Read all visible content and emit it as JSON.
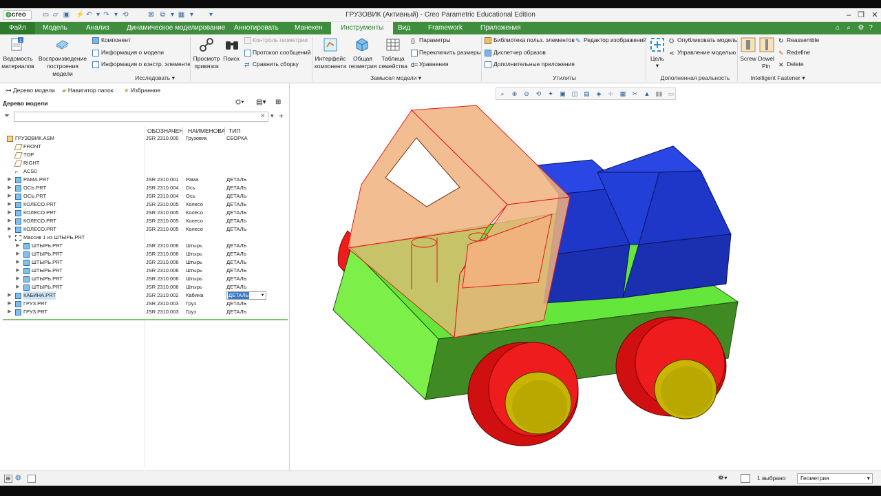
{
  "app": {
    "logo": "creo",
    "window_title": "ГРУЗОВИК (Активный) - Creo Parametric Educational Edition",
    "window_controls": [
      "minimize-icon",
      "restore-icon",
      "close-icon"
    ]
  },
  "tabs": [
    {
      "label": "Файл",
      "type": "file"
    },
    {
      "label": "Модель"
    },
    {
      "label": "Анализ"
    },
    {
      "label": "Динамическое моделирование"
    },
    {
      "label": "Аннотировать"
    },
    {
      "label": "Манекен"
    },
    {
      "label": "Инструменты",
      "active": true
    },
    {
      "label": "Вид"
    },
    {
      "label": "Framework"
    },
    {
      "label": "Приложения"
    }
  ],
  "ribbon": {
    "investigate": {
      "bom": "Ведомость\nматериалов",
      "playback": "Воспроизведение\nпостроения модели",
      "component": "Компонент",
      "model_info": "Информация о модели",
      "feature_info": "Информация о констр. элементе",
      "refs_viewer": "Просмотр\nпривязок",
      "search": "Поиск",
      "geom_check": "Контроль геометрии",
      "msg_log": "Протокол сообщений",
      "compare_asm": "Сравнить сборку",
      "group": "Исследовать"
    },
    "model_intent": {
      "comp_interface": "Интерфейс\nкомпонента",
      "pub_geom": "Общая\nгеометрия",
      "family_table": "Таблица\nсемейства",
      "params": "Параметры",
      "switch_dims": "Переключить размеры",
      "relations": "Уравнения",
      "group": "Замысел модели"
    },
    "utilities": {
      "udf_lib": "Библиотека польз. элементов",
      "image_editor": "Редактор изображений",
      "image_manager": "Диспетчер образов",
      "aux_apps": "Дополнительные приложения",
      "group": "Утилиты"
    },
    "ar": {
      "target": "Цель",
      "publish": "Опубликовать модель",
      "manage": "Управление моделью",
      "group": "Дополненная реальность"
    },
    "fastener": {
      "screw": "Screw",
      "dowel": "Dowel\nPin",
      "reassemble": "Reassemble",
      "redefine": "Redefine",
      "delete": "Delete",
      "group": "Intelligent Fastener"
    }
  },
  "panel": {
    "tabs": [
      "Дерево модели",
      "Навигатор папок",
      "Избранное"
    ],
    "tree_title": "Дерево модели",
    "filter_placeholder": "",
    "columns": [
      "ОБОЗНАЧЕНИ",
      "НАИМЕНОВА",
      "ТИП"
    ],
    "rows": [
      {
        "name": "ГРУЗОВИК.ASM",
        "code": "JSR 2310.000",
        "title": "Грузовик",
        "type": "СБОРКА",
        "depth": 0,
        "icon": "assembly",
        "exp": ""
      },
      {
        "name": "FRONT",
        "code": "",
        "title": "",
        "type": "",
        "depth": 1,
        "icon": "plane",
        "exp": ""
      },
      {
        "name": "TOP",
        "code": "",
        "title": "",
        "type": "",
        "depth": 1,
        "icon": "plane",
        "exp": ""
      },
      {
        "name": "RIGHT",
        "code": "",
        "title": "",
        "type": "",
        "depth": 1,
        "icon": "plane",
        "exp": ""
      },
      {
        "name": "ACS0",
        "code": "",
        "title": "",
        "type": "",
        "depth": 1,
        "icon": "csys",
        "exp": ""
      },
      {
        "name": "РАМА.PRT",
        "code": "JSR 2310.001",
        "title": "Рама",
        "type": "ДЕТАЛЬ",
        "depth": 1,
        "icon": "part",
        "exp": "▶"
      },
      {
        "name": "ОСЬ.PRT",
        "code": "JSR 2310.004",
        "title": "Ось",
        "type": "ДЕТАЛЬ",
        "depth": 1,
        "icon": "part",
        "exp": "▶"
      },
      {
        "name": "ОСЬ.PRT",
        "code": "JSR 2310.004",
        "title": "Ось",
        "type": "ДЕТАЛЬ",
        "depth": 1,
        "icon": "part",
        "exp": "▶"
      },
      {
        "name": "КОЛЕСО.PRT",
        "code": "JSR 2310.005",
        "title": "Колесо",
        "type": "ДЕТАЛЬ",
        "depth": 1,
        "icon": "part",
        "exp": "▶"
      },
      {
        "name": "КОЛЕСО.PRT",
        "code": "JSR 2310.005",
        "title": "Колесо",
        "type": "ДЕТАЛЬ",
        "depth": 1,
        "icon": "part",
        "exp": "▶"
      },
      {
        "name": "КОЛЕСО.PRT",
        "code": "JSR 2310.005",
        "title": "Колесо",
        "type": "ДЕТАЛЬ",
        "depth": 1,
        "icon": "part",
        "exp": "▶"
      },
      {
        "name": "КОЛЕСО.PRT",
        "code": "JSR 2310.005",
        "title": "Колесо",
        "type": "ДЕТАЛЬ",
        "depth": 1,
        "icon": "part",
        "exp": "▶"
      },
      {
        "name": "Массив 1 из ШТЫРЬ.PRT",
        "code": "",
        "title": "",
        "type": "",
        "depth": 1,
        "icon": "pattern",
        "exp": "▼"
      },
      {
        "name": "ШТЫРЬ.PRT",
        "code": "JSR 2310.006",
        "title": "Штырь",
        "type": "ДЕТАЛЬ",
        "depth": 2,
        "icon": "part",
        "exp": "▶"
      },
      {
        "name": "ШТЫРЬ.PRT",
        "code": "JSR 2310.006",
        "title": "Штырь",
        "type": "ДЕТАЛЬ",
        "depth": 2,
        "icon": "part",
        "exp": "▶"
      },
      {
        "name": "ШТЫРЬ.PRT",
        "code": "JSR 2310.006",
        "title": "Штырь",
        "type": "ДЕТАЛЬ",
        "depth": 2,
        "icon": "part",
        "exp": "▶"
      },
      {
        "name": "ШТЫРЬ.PRT",
        "code": "JSR 2310.006",
        "title": "Штырь",
        "type": "ДЕТАЛЬ",
        "depth": 2,
        "icon": "part",
        "exp": "▶"
      },
      {
        "name": "ШТЫРЬ.PRT",
        "code": "JSR 2310.006",
        "title": "Штырь",
        "type": "ДЕТАЛЬ",
        "depth": 2,
        "icon": "part",
        "exp": "▶"
      },
      {
        "name": "ШТЫРЬ.PRT",
        "code": "JSR 2310.006",
        "title": "Штырь",
        "type": "ДЕТАЛЬ",
        "depth": 2,
        "icon": "part",
        "exp": "▶"
      },
      {
        "name": "КАБИНА.PRT",
        "code": "JSR 2310.002",
        "title": "Кабина",
        "type": "ДЕТАЛЬ",
        "depth": 1,
        "icon": "part",
        "exp": "▶",
        "selected": true,
        "editing": true
      },
      {
        "name": "ГРУЗ.PRT",
        "code": "JSR 2310.003",
        "title": "Груз",
        "type": "ДЕТАЛЬ",
        "depth": 1,
        "icon": "part",
        "exp": "▶"
      },
      {
        "name": "ГРУЗ.PRT",
        "code": "JSR 2310.003",
        "title": "Груз",
        "type": "ДЕТАЛЬ",
        "depth": 1,
        "icon": "part",
        "exp": "▶"
      }
    ]
  },
  "status": {
    "selected": "1 выбрано",
    "filter": "Геометрия"
  },
  "colors": {
    "tab_green": "#3e8e3e",
    "frame_green": "#5fe63a",
    "cab_orange": "#f0b37e",
    "cargo_blue": "#1e3cd6",
    "tire_red": "#ee1c1c",
    "rim_yellow": "#c9b400"
  }
}
